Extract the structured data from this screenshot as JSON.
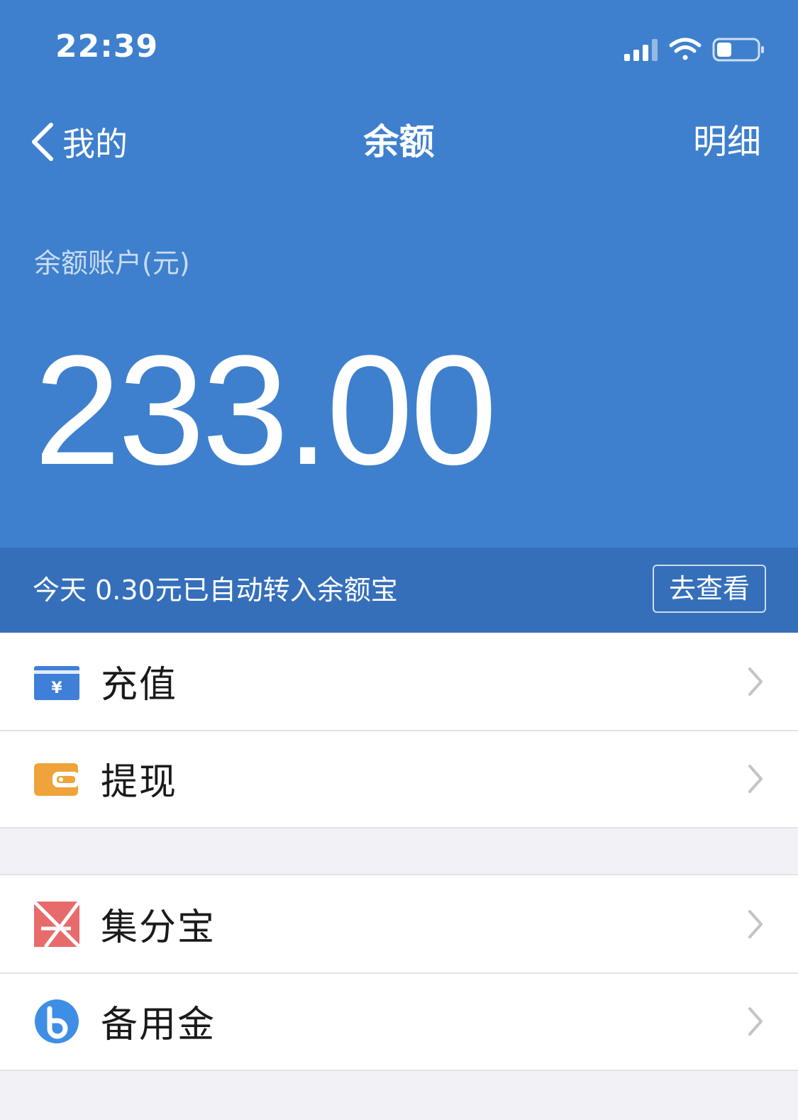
{
  "status_bar": {
    "time": "22:39"
  },
  "nav": {
    "back_label": "我的",
    "title": "余额",
    "detail_label": "明细"
  },
  "account": {
    "label": "余额账户(元)",
    "balance": "233.00"
  },
  "banner": {
    "text": "今天 0.30元已自动转入余额宝",
    "button_label": "去查看"
  },
  "groups": [
    {
      "items": [
        {
          "label": "充值",
          "icon": "recharge-card-icon",
          "icon_color": "#3e80d8"
        },
        {
          "label": "提现",
          "icon": "wallet-icon",
          "icon_color": "#f0a33a"
        }
      ]
    },
    {
      "items": [
        {
          "label": "集分宝",
          "icon": "jifenbao-icon",
          "icon_color": "#e86b6b"
        },
        {
          "label": "备用金",
          "icon": "beiyongjin-icon",
          "icon_color": "#3f8ee6"
        }
      ]
    }
  ],
  "colors": {
    "header_blue": "#3e80cd",
    "banner_blue": "#356fba",
    "page_background": "#f2f2f6"
  }
}
